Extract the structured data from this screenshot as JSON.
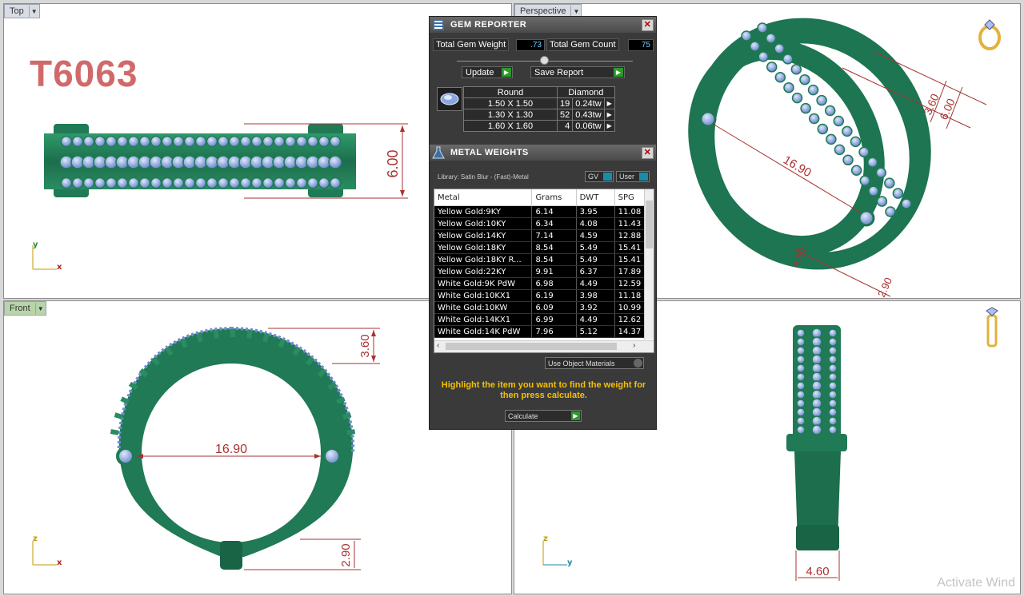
{
  "viewports": {
    "top": {
      "label": "Top"
    },
    "perspective": {
      "label": "Perspective"
    },
    "front": {
      "label": "Front"
    }
  },
  "model_label": "T6063",
  "dimensions": {
    "top_width": "6.00",
    "persp_width_a": "3.60",
    "persp_width_b": "6.00",
    "persp_diameter": "16.90",
    "persp_bottom": "4.60",
    "persp_bottom_b": "2.90",
    "front_top": "3.60",
    "front_diameter": "16.90",
    "front_bottom": "2.90",
    "right_bottom": "4.60"
  },
  "axes": {
    "x": "x",
    "y": "y",
    "z": "z"
  },
  "gem_reporter": {
    "title": "GEM REPORTER",
    "total_weight_label": "Total Gem Weight",
    "total_weight": ".73",
    "total_count_label": "Total Gem Count",
    "total_count": "75",
    "update_label": "Update",
    "save_label": "Save Report",
    "shape": "Round",
    "type": "Diamond",
    "rows": [
      {
        "size": "1.50 X 1.50",
        "count": "19",
        "weight": "0.24tw"
      },
      {
        "size": "1.30 X 1.30",
        "count": "52",
        "weight": "0.43tw"
      },
      {
        "size": "1.60 X 1.60",
        "count": "4",
        "weight": "0.06tw"
      }
    ]
  },
  "metal_weights": {
    "title": "METAL WEIGHTS",
    "library": "Library: Satin Blur - (Fast)-Metal",
    "gv_label": "GV",
    "user_label": "User",
    "columns": [
      "Metal",
      "Grams",
      "DWT",
      "SPG"
    ],
    "rows": [
      {
        "metal": "Yellow Gold:9KY",
        "grams": "6.14",
        "dwt": "3.95",
        "spg": "11.08"
      },
      {
        "metal": "Yellow Gold:10KY",
        "grams": "6.34",
        "dwt": "4.08",
        "spg": "11.43"
      },
      {
        "metal": "Yellow Gold:14KY",
        "grams": "7.14",
        "dwt": "4.59",
        "spg": "12.88"
      },
      {
        "metal": "Yellow Gold:18KY",
        "grams": "8.54",
        "dwt": "5.49",
        "spg": "15.41"
      },
      {
        "metal": "Yellow Gold:18KY R...",
        "grams": "8.54",
        "dwt": "5.49",
        "spg": "15.41"
      },
      {
        "metal": "Yellow Gold:22KY",
        "grams": "9.91",
        "dwt": "6.37",
        "spg": "17.89"
      },
      {
        "metal": "White Gold:9K PdW",
        "grams": "6.98",
        "dwt": "4.49",
        "spg": "12.59"
      },
      {
        "metal": "White Gold:10KX1",
        "grams": "6.19",
        "dwt": "3.98",
        "spg": "11.18"
      },
      {
        "metal": "White Gold:10KW",
        "grams": "6.09",
        "dwt": "3.92",
        "spg": "10.99"
      },
      {
        "metal": "White Gold:14KX1",
        "grams": "6.99",
        "dwt": "4.49",
        "spg": "12.62"
      },
      {
        "metal": "White Gold:14K PdW",
        "grams": "7.96",
        "dwt": "5.12",
        "spg": "14.37"
      }
    ],
    "use_object_materials": "Use Object Materials",
    "hint": "Highlight the item you want to find the weight for then press calculate.",
    "calculate_label": "Calculate"
  },
  "watermark": "Activate Wind",
  "colors": {
    "metal": "#1f7a55",
    "gem": "#8aa6de",
    "dimension": "#a83232",
    "label": "#d06a6a"
  }
}
